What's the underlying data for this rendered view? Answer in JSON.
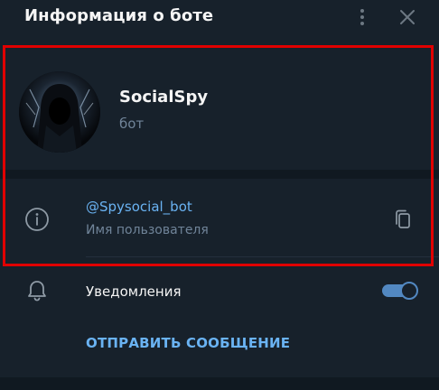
{
  "header": {
    "title": "Информация о боте",
    "menu_icon": "more-vertical-icon",
    "close_icon": "close-icon"
  },
  "profile": {
    "name": "SocialSpy",
    "subtitle": "бот",
    "avatar": "hooded-figure-avatar"
  },
  "info": {
    "icon": "info-icon",
    "username": "@Spysocial_bot",
    "username_label": "Имя пользователя",
    "copy_icon": "copy-icon"
  },
  "notifications": {
    "icon": "bell-icon",
    "label": "Уведомления",
    "enabled": true
  },
  "actions": {
    "send_message": "ОТПРАВИТЬ СООБЩЕНИЕ"
  },
  "colors": {
    "background": "#17212b",
    "divider": "#101921",
    "accent": "#6ab3f3",
    "toggle": "#5288c1",
    "secondary_text": "#708499",
    "highlight": "#e00000"
  }
}
